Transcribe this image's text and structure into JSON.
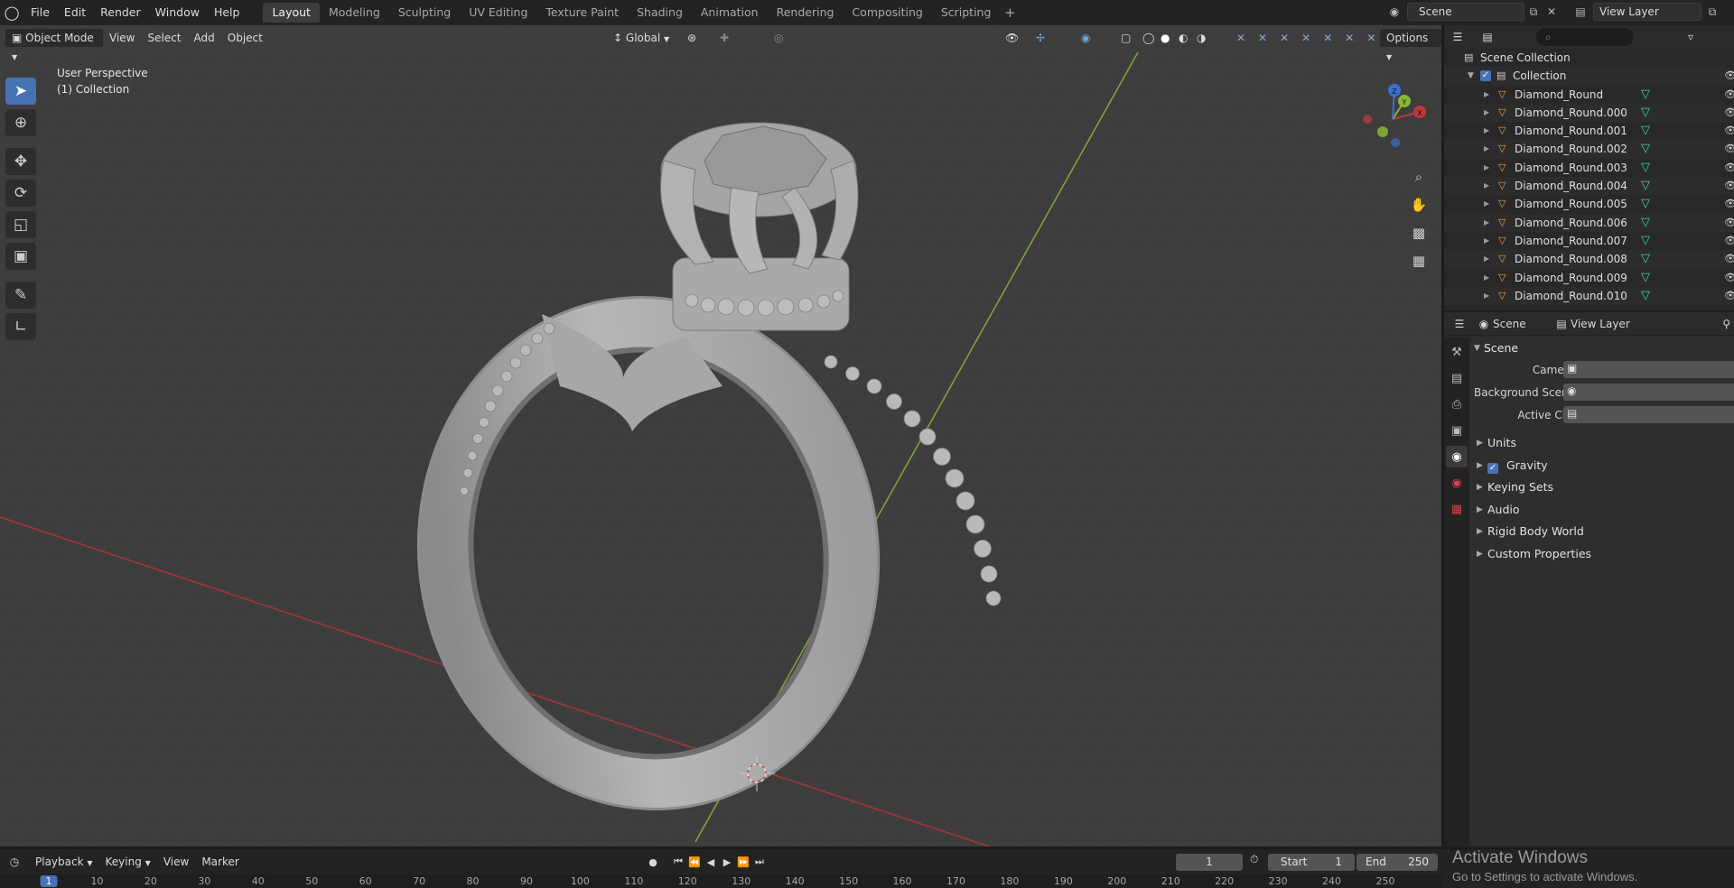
{
  "topbar": {
    "menus": [
      "File",
      "Edit",
      "Render",
      "Window",
      "Help"
    ],
    "workspaces": [
      "Layout",
      "Modeling",
      "Sculpting",
      "UV Editing",
      "Texture Paint",
      "Shading",
      "Animation",
      "Rendering",
      "Compositing",
      "Scripting"
    ],
    "active_workspace": "Layout",
    "scene_name": "Scene",
    "view_layer_name": "View Layer"
  },
  "viewport": {
    "mode": "Object Mode",
    "menus": [
      "View",
      "Select",
      "Add",
      "Object"
    ],
    "transform_orientation": "Global",
    "options_label": "Options",
    "info_line1": "User Perspective",
    "info_line2": "(1) Collection",
    "gizmo": {
      "x": "X",
      "y": "Y",
      "z": "Z"
    },
    "colors": {
      "x_axis": "#c0373b",
      "y_axis": "#8bb533",
      "active_tool": "#4772b3"
    }
  },
  "outliner": {
    "search_placeholder": "",
    "root": "Scene Collection",
    "collection": "Collection",
    "objects": [
      "Diamond_Round",
      "Diamond_Round.000",
      "Diamond_Round.001",
      "Diamond_Round.002",
      "Diamond_Round.003",
      "Diamond_Round.004",
      "Diamond_Round.005",
      "Diamond_Round.006",
      "Diamond_Round.007",
      "Diamond_Round.008",
      "Diamond_Round.009",
      "Diamond_Round.010"
    ]
  },
  "properties": {
    "breadcrumb_scene": "Scene",
    "breadcrumb_layer": "View Layer",
    "panel_title": "Scene",
    "fields": {
      "camera": "Camera",
      "background_scene": "Background Scene",
      "active_clip": "Active Clip"
    },
    "subpanels": {
      "units": "Units",
      "gravity": "Gravity",
      "keying_sets": "Keying Sets",
      "audio": "Audio",
      "rigid_body_world": "Rigid Body World",
      "custom_properties": "Custom Properties"
    }
  },
  "timeline": {
    "menus": {
      "playback": "Playback",
      "keying": "Keying",
      "view": "View",
      "marker": "Marker"
    },
    "current_frame": "1",
    "start_label": "Start",
    "start_value": "1",
    "end_label": "End",
    "end_value": "250",
    "ruler": [
      "1",
      "10",
      "20",
      "30",
      "40",
      "50",
      "60",
      "70",
      "80",
      "90",
      "100",
      "110",
      "120",
      "130",
      "140",
      "150",
      "160",
      "170",
      "180",
      "190",
      "200",
      "210",
      "220",
      "230",
      "240",
      "250"
    ]
  },
  "watermark": {
    "line1": "Activate Windows",
    "line2": "Go to Settings to activate Windows."
  }
}
